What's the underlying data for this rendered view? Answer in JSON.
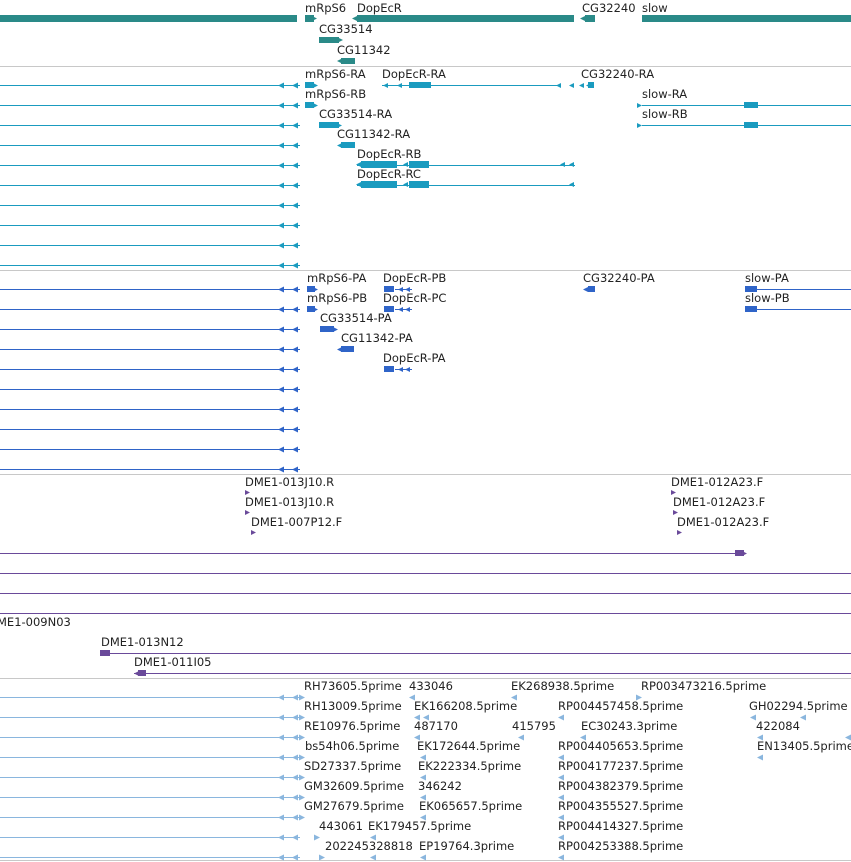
{
  "colors": {
    "gene": "#2a8a88",
    "transcript": "#1a9bbf",
    "protein": "#2f64c8",
    "clone": "#6a4a9a",
    "est": "#8ab6de",
    "separator": "#c8c8c8"
  },
  "tracks": {
    "genes": {
      "labels": [
        "mRpS6",
        "DopEcR",
        "CG32240",
        "slow",
        "CG33514",
        "CG11342"
      ]
    },
    "transcripts": {
      "labels": [
        "mRpS6-RA",
        "DopEcR-RA",
        "CG32240-RA",
        "mRpS6-RB",
        "slow-RA",
        "slow-RB",
        "CG33514-RA",
        "CG11342-RA",
        "DopEcR-RB",
        "DopEcR-RC"
      ]
    },
    "proteins": {
      "labels": [
        "mRpS6-PA",
        "DopEcR-PB",
        "CG32240-PA",
        "slow-PA",
        "mRpS6-PB",
        "DopEcR-PC",
        "slow-PB",
        "CG33514-PA",
        "CG11342-PA",
        "DopEcR-PA"
      ]
    },
    "clones": {
      "labels": [
        "DME1-013J10.R",
        "DME1-013J10.R",
        "DME1-007P12.F",
        "DME1-012A23.F",
        "DME1-012A23.F",
        "DME1-012A23.F",
        "ME1-009N03",
        "DME1-013N12",
        "DME1-011I05"
      ]
    },
    "ests": {
      "labels": [
        "RH73605.5prime",
        "433046",
        "EK268938.5prime",
        "RP003473216.5prime",
        "RH13009.5prime",
        "EK166208.5prime",
        "RP004457458.5prime",
        "GH02294.5prime",
        "RE10976.5prime",
        "487170",
        "415795",
        "EC30243.3prime",
        "422084",
        "bs54h06.5prime",
        "EK172644.5prime",
        "RP004405653.5prime",
        "EN13405.5prime",
        "SD27337.5prime",
        "EK222334.5prime",
        "RP004177237.5prime",
        "GM32609.5prime",
        "346242",
        "RP004382379.5prime",
        "GM27679.5prime",
        "EK065657.5prime",
        "RP004355527.5prime",
        "443061",
        "EK179457.5prime",
        "RP004414327.5prime",
        "202245328818",
        "EP19764.3prime",
        "RP004253388.5prime"
      ]
    }
  }
}
